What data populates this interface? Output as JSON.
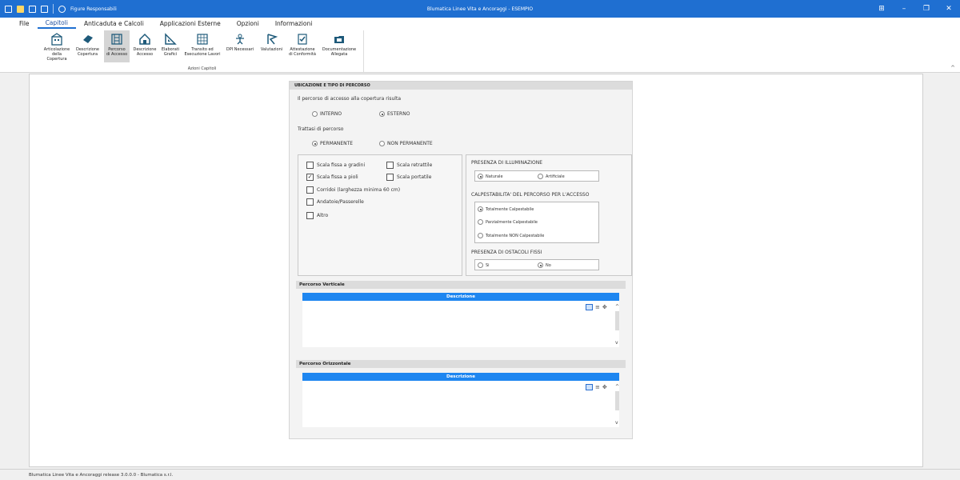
{
  "titlebar": {
    "quick_access_label": "Figure Responsabili",
    "title": "Blumatica Linee Vita e Ancoraggi - ESEMPIO"
  },
  "menu": [
    "File",
    "Capitoli",
    "Anticaduta e Calcoli",
    "Applicazioni Esterne",
    "Opzioni",
    "Informazioni"
  ],
  "menu_active": "Capitoli",
  "ribbon": {
    "group_label": "Azioni Capitoli",
    "buttons": [
      {
        "label1": "Articolazione",
        "label2": "della Copertura",
        "icon": "building-icon"
      },
      {
        "label1": "Descrizione",
        "label2": "Copertura",
        "icon": "roof-icon"
      },
      {
        "label1": "Percorso",
        "label2": "di Accesso",
        "icon": "ladder-icon",
        "selected": true
      },
      {
        "label1": "Descrizione",
        "label2": "Accesso",
        "icon": "house-icon"
      },
      {
        "label1": "Elaborati",
        "label2": "Grafici",
        "icon": "triangle-ruler-icon"
      },
      {
        "label1": "Transito ed",
        "label2": "Esecuzione Lavori",
        "icon": "grid-icon"
      },
      {
        "label1": "DPI Necessari",
        "label2": "",
        "icon": "harness-icon"
      },
      {
        "label1": "Valutazioni",
        "label2": "",
        "icon": "flag-icon"
      },
      {
        "label1": "Attestazione",
        "label2": "di Conformità",
        "icon": "certificate-icon"
      },
      {
        "label1": "Documentazione",
        "label2": "Allegata",
        "icon": "folder-icon"
      }
    ]
  },
  "panel": {
    "header": "UBICAZIONE E TIPO DI PERCORSO",
    "q1": "Il percorso di accesso alla copertura risulta",
    "q1_options": [
      {
        "label": "INTERNO",
        "checked": false
      },
      {
        "label": "ESTERNO",
        "checked": true
      }
    ],
    "q2": "Trattasi di percorso",
    "q2_options": [
      {
        "label": "PERMANENTE",
        "checked": true
      },
      {
        "label": "NON PERMANENTE",
        "checked": false
      }
    ],
    "checkboxes": [
      {
        "label": "Scala fissa a gradini",
        "checked": false
      },
      {
        "label": "Scala retrattile",
        "checked": false
      },
      {
        "label": "Scala fissa a pioli",
        "checked": true
      },
      {
        "label": "Scala portatile",
        "checked": false
      },
      {
        "label": "Corridoi (larghezza minima 60 cm)",
        "checked": false
      },
      {
        "label": "Andatoie/Passerelle",
        "checked": false
      },
      {
        "label": "Altro",
        "checked": false
      }
    ],
    "illuminazione": {
      "title": "PRESENZA DI ILLUMINAZIONE",
      "options": [
        {
          "label": "Naturale",
          "checked": true
        },
        {
          "label": "Artificiale",
          "checked": false
        }
      ]
    },
    "calpestabilita": {
      "title": "CALPESTABILITA' DEL PERCORSO PER L'ACCESSO",
      "options": [
        {
          "label": "Totalmente Calpestabile",
          "checked": true
        },
        {
          "label": "Parzialmente Calpestabile",
          "checked": false
        },
        {
          "label": "Totalmente NON Calpestabile",
          "checked": false
        }
      ]
    },
    "ostacoli": {
      "title": "PRESENZA DI OSTACOLI FISSI",
      "options": [
        {
          "label": "Si",
          "checked": false
        },
        {
          "label": "No",
          "checked": true
        }
      ]
    },
    "verticale": {
      "title": "Percorso Verticale",
      "desc_header": "Descrizione"
    },
    "orizzontale": {
      "title": "Percorso Orizzontale",
      "desc_header": "Descrizione"
    }
  },
  "statusbar": "Blumatica Linee Vita e Ancoraggi release 3.0.0.0 - Blumatica s.r.l."
}
